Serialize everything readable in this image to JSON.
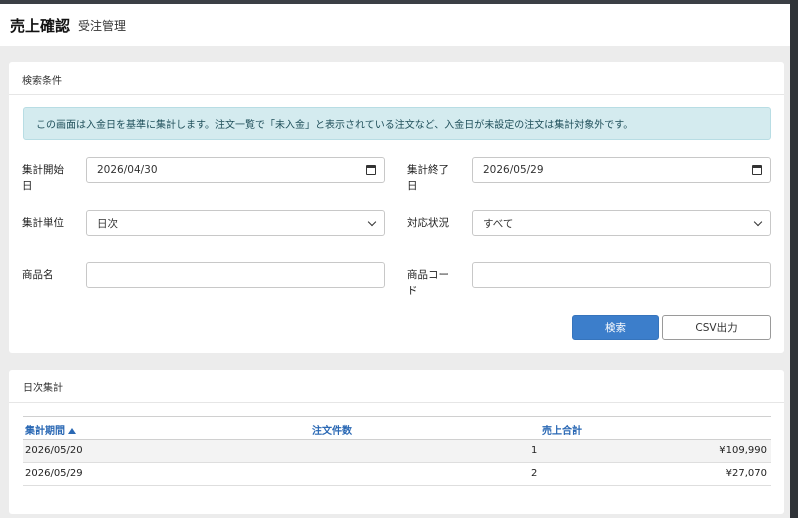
{
  "header": {
    "title": "売上確認",
    "subtitle": "受注管理"
  },
  "search": {
    "title": "検索条件",
    "info": "この画面は入金日を基準に集計します。注文一覧で「未入金」と表示されている注文など、入金日が未設定の注文は集計対象外です。",
    "start_label": "集計開始日",
    "start_value": "2026/04/30",
    "end_label": "集計終了日",
    "end_value": "2026/05/29",
    "unit_label": "集計単位",
    "unit_value": "日次",
    "status_label": "対応状況",
    "status_value": "すべて",
    "product_name_label": "商品名",
    "product_name_value": "",
    "product_code_label": "商品コード",
    "product_code_value": "",
    "search_button": "検索",
    "csv_button": "CSV出力"
  },
  "results": {
    "title": "日次集計",
    "columns": {
      "period": "集計期間",
      "orders": "注文件数",
      "total": "売上合計"
    },
    "rows": [
      {
        "period": "2026/05/20",
        "orders": "1",
        "total": "¥109,990"
      },
      {
        "period": "2026/05/29",
        "orders": "2",
        "total": "¥27,070"
      }
    ]
  }
}
